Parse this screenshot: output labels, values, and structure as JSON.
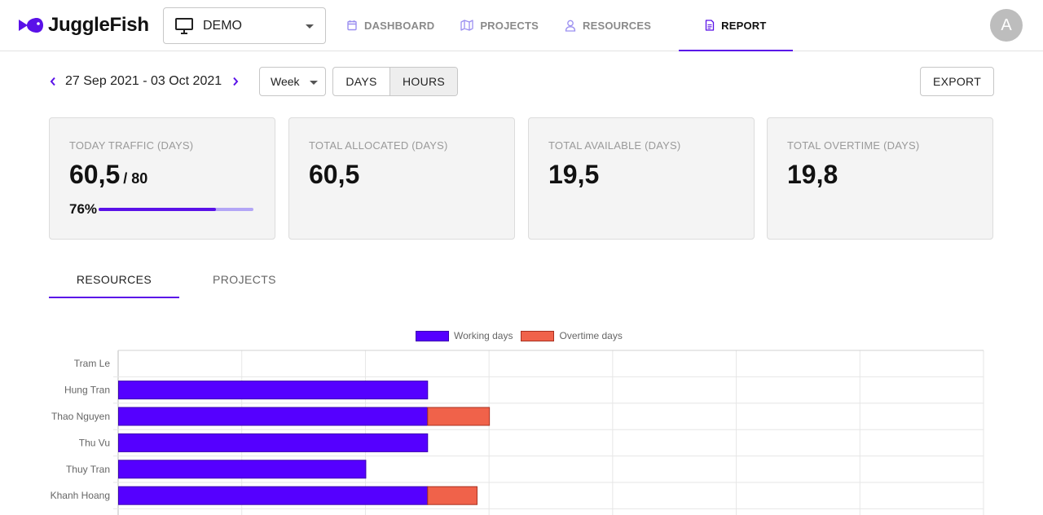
{
  "header": {
    "app_name": "JuggleFish",
    "project": "DEMO",
    "nav": [
      {
        "label": "DASHBOARD",
        "icon": "calendar-icon",
        "active": false
      },
      {
        "label": "PROJECTS",
        "icon": "map-icon",
        "active": false
      },
      {
        "label": "RESOURCES",
        "icon": "user-icon",
        "active": false
      },
      {
        "label": "REPORT",
        "icon": "document-icon",
        "active": true
      }
    ],
    "avatar_initial": "A"
  },
  "toolbar": {
    "date_range": "27 Sep 2021 - 03 Oct 2021",
    "period": "Week",
    "unit_days": "DAYS",
    "unit_hours": "HOURS",
    "export": "EXPORT"
  },
  "cards": [
    {
      "title": "TODAY TRAFFIC (DAYS)",
      "value": "60,5",
      "sub": "/ 80",
      "percent_label": "76%",
      "percent": 0.76
    },
    {
      "title": "TOTAL ALLOCATED (DAYS)",
      "value": "60,5"
    },
    {
      "title": "TOTAL AVAILABLE (DAYS)",
      "value": "19,5"
    },
    {
      "title": "TOTAL OVERTIME (DAYS)",
      "value": "19,8"
    }
  ],
  "tabs": [
    {
      "label": "RESOURCES",
      "active": true
    },
    {
      "label": "PROJECTS",
      "active": false
    }
  ],
  "colors": {
    "accent": "#5a11e8",
    "working": "#5500ff",
    "overtime": "#f0624a"
  },
  "chart_data": {
    "type": "bar",
    "orientation": "horizontal",
    "stacked": true,
    "categories": [
      "Tram Le",
      "Hung Tran",
      "Thao Nguyen",
      "Thu Vu",
      "Thuy Tran",
      "Khanh Hoang"
    ],
    "series": [
      {
        "name": "Working days",
        "values": [
          0,
          2.5,
          2.5,
          2.5,
          2,
          2.5
        ]
      },
      {
        "name": "Overtime days",
        "values": [
          0,
          0,
          0.5,
          0,
          0,
          0.4
        ]
      }
    ],
    "xlim": [
      0,
      7
    ],
    "grid": true,
    "legend": "top-center"
  }
}
